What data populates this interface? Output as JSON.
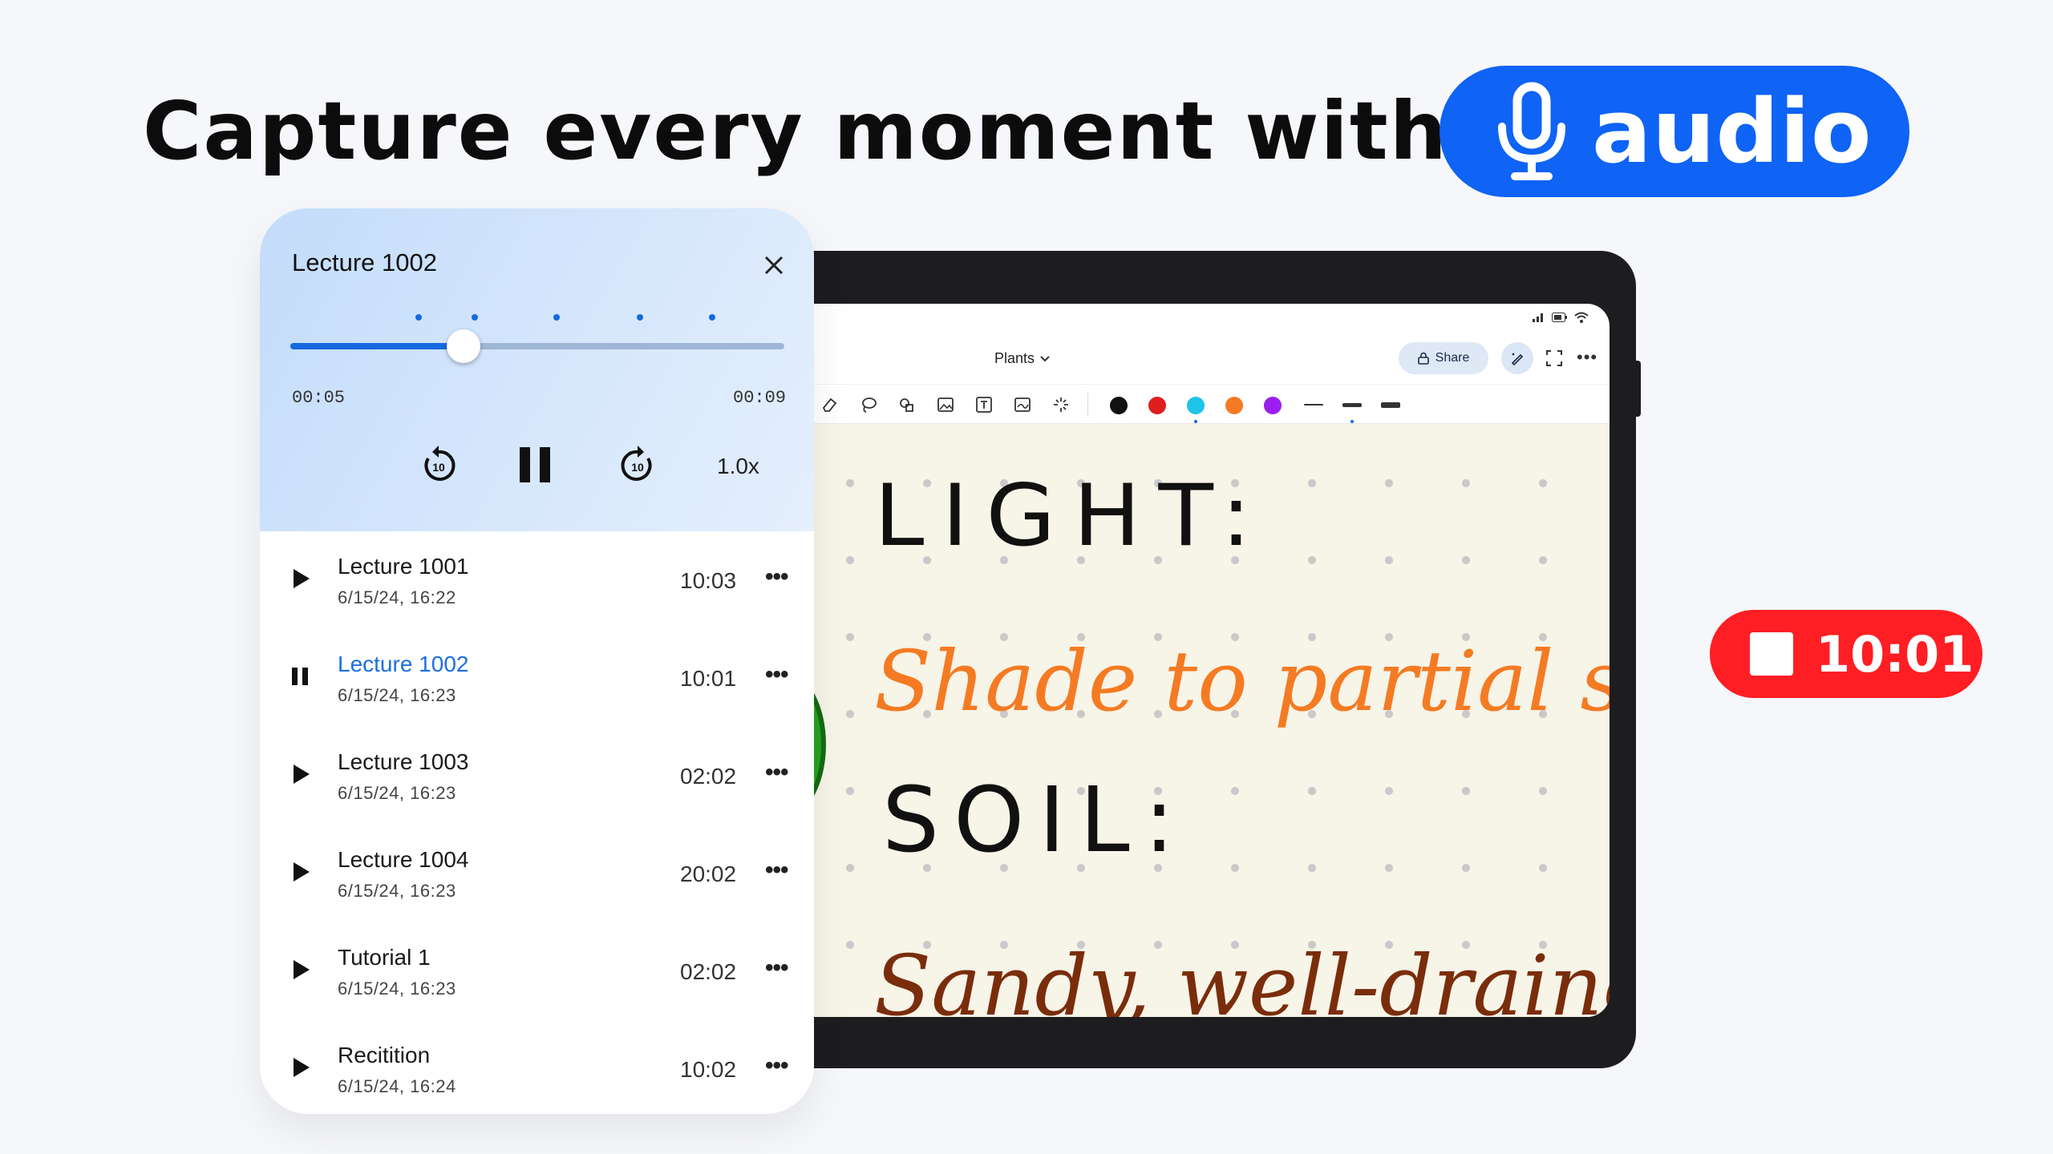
{
  "headline": {
    "text": "Capture every moment with",
    "pill_label": "audio"
  },
  "recording": {
    "time": "10:01"
  },
  "tablet": {
    "doc_title": "Plants",
    "share_label": "Share",
    "colors": [
      "#111111",
      "#e01e1e",
      "#1fc3e8",
      "#f47b23",
      "#9b1ef0"
    ],
    "handwriting": {
      "line1": "LIGHT:",
      "line2": "Shade to partial sun",
      "line3": "SOIL:",
      "line4": "Sandy, well-drained"
    }
  },
  "player": {
    "title": "Lecture 1002",
    "elapsed": "00:05",
    "total": "00:09",
    "speed": "1.0x",
    "progress_fraction": 0.35,
    "recordings": [
      {
        "name": "Lecture 1001",
        "date": "6/15/24, 16:22",
        "duration": "10:03",
        "state": "play"
      },
      {
        "name": "Lecture 1002",
        "date": "6/15/24, 16:23",
        "duration": "10:01",
        "state": "pause"
      },
      {
        "name": "Lecture 1003",
        "date": "6/15/24, 16:23",
        "duration": "02:02",
        "state": "play"
      },
      {
        "name": "Lecture 1004",
        "date": "6/15/24, 16:23",
        "duration": "20:02",
        "state": "play"
      },
      {
        "name": "Tutorial 1",
        "date": "6/15/24, 16:23",
        "duration": "02:02",
        "state": "play"
      },
      {
        "name": "Recitition",
        "date": "6/15/24, 16:24",
        "duration": "10:02",
        "state": "play"
      }
    ],
    "more_glyph": "•••"
  }
}
